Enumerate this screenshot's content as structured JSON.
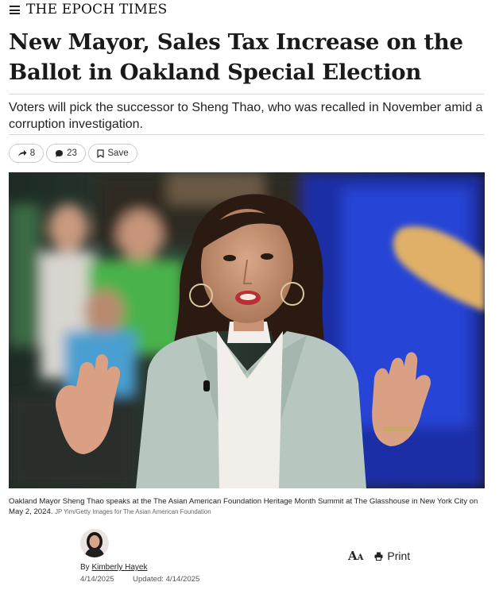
{
  "header": {
    "masthead": "THE EPOCH TIMES",
    "menu_icon": "hamburger-menu-icon"
  },
  "article": {
    "headline": "New Mayor, Sales Tax Increase on the Ballot in Oakland Special Election",
    "subheadline": "Voters will pick the successor to Sheng Thao, who was recalled in November amid a corruption investigation.",
    "share_count": "8",
    "comment_count": "23",
    "save_label": "Save",
    "caption": "Oakland Mayor Sheng Thao speaks at the The Asian American Foundation Heritage Month Summit at The Glasshouse in New York City on May 2, 2024.",
    "photo_credit": "JP Yim/Getty Images for The Asian American Foundation",
    "byline_prefix": "By",
    "author": "Kimberly Hayek",
    "published": "4/14/2025",
    "updated_label": "Updated:",
    "updated": "4/14/2025"
  },
  "tools": {
    "font_size_label": "A",
    "font_size_small": "A",
    "print_label": "Print"
  },
  "icons": {
    "share": "share-arrow-icon",
    "comment": "comment-bubble-icon",
    "save": "bookmark-icon",
    "print": "printer-icon"
  },
  "colors": {
    "headline": "#1a1a1a",
    "rule": "#d9d9d9",
    "pill_border": "#c9cdd3"
  }
}
